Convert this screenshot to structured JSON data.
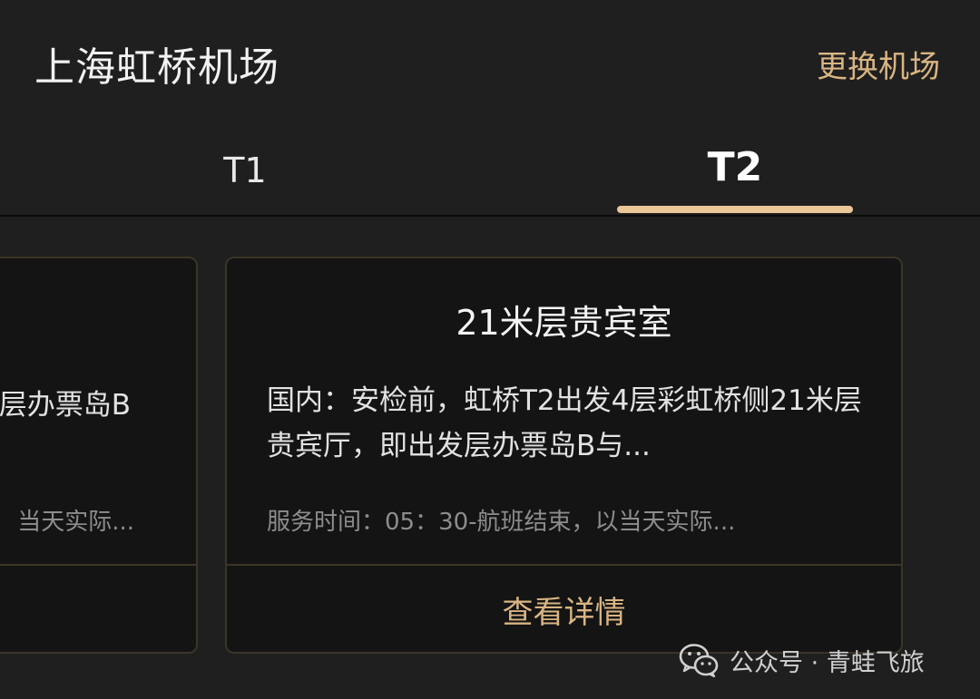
{
  "header": {
    "title": "上海虹桥机场",
    "change_airport": "更换机场"
  },
  "tabs": [
    {
      "label": "T1",
      "selected": false
    },
    {
      "label": "T2",
      "selected": true
    }
  ],
  "colors": {
    "accent": "#d9b583",
    "indicator": "#eac699",
    "background": "#1f1f1f",
    "card_bg": "#141414"
  },
  "cards": {
    "left_partial": {
      "desc": "层办票岛B",
      "hours": "当天实际..."
    },
    "main": {
      "title": "21米层贵宾室",
      "desc": "国内：安检前，虹桥T2出发4层彩虹桥侧21米层贵宾厅，即出发层办票岛B与...",
      "hours": "服务时间：05：30-航班结束，以当天实际...",
      "detail_button": "查看详情"
    }
  },
  "watermark": {
    "icon": "wechat-icon",
    "text": "公众号 · 青蛙飞旅"
  }
}
